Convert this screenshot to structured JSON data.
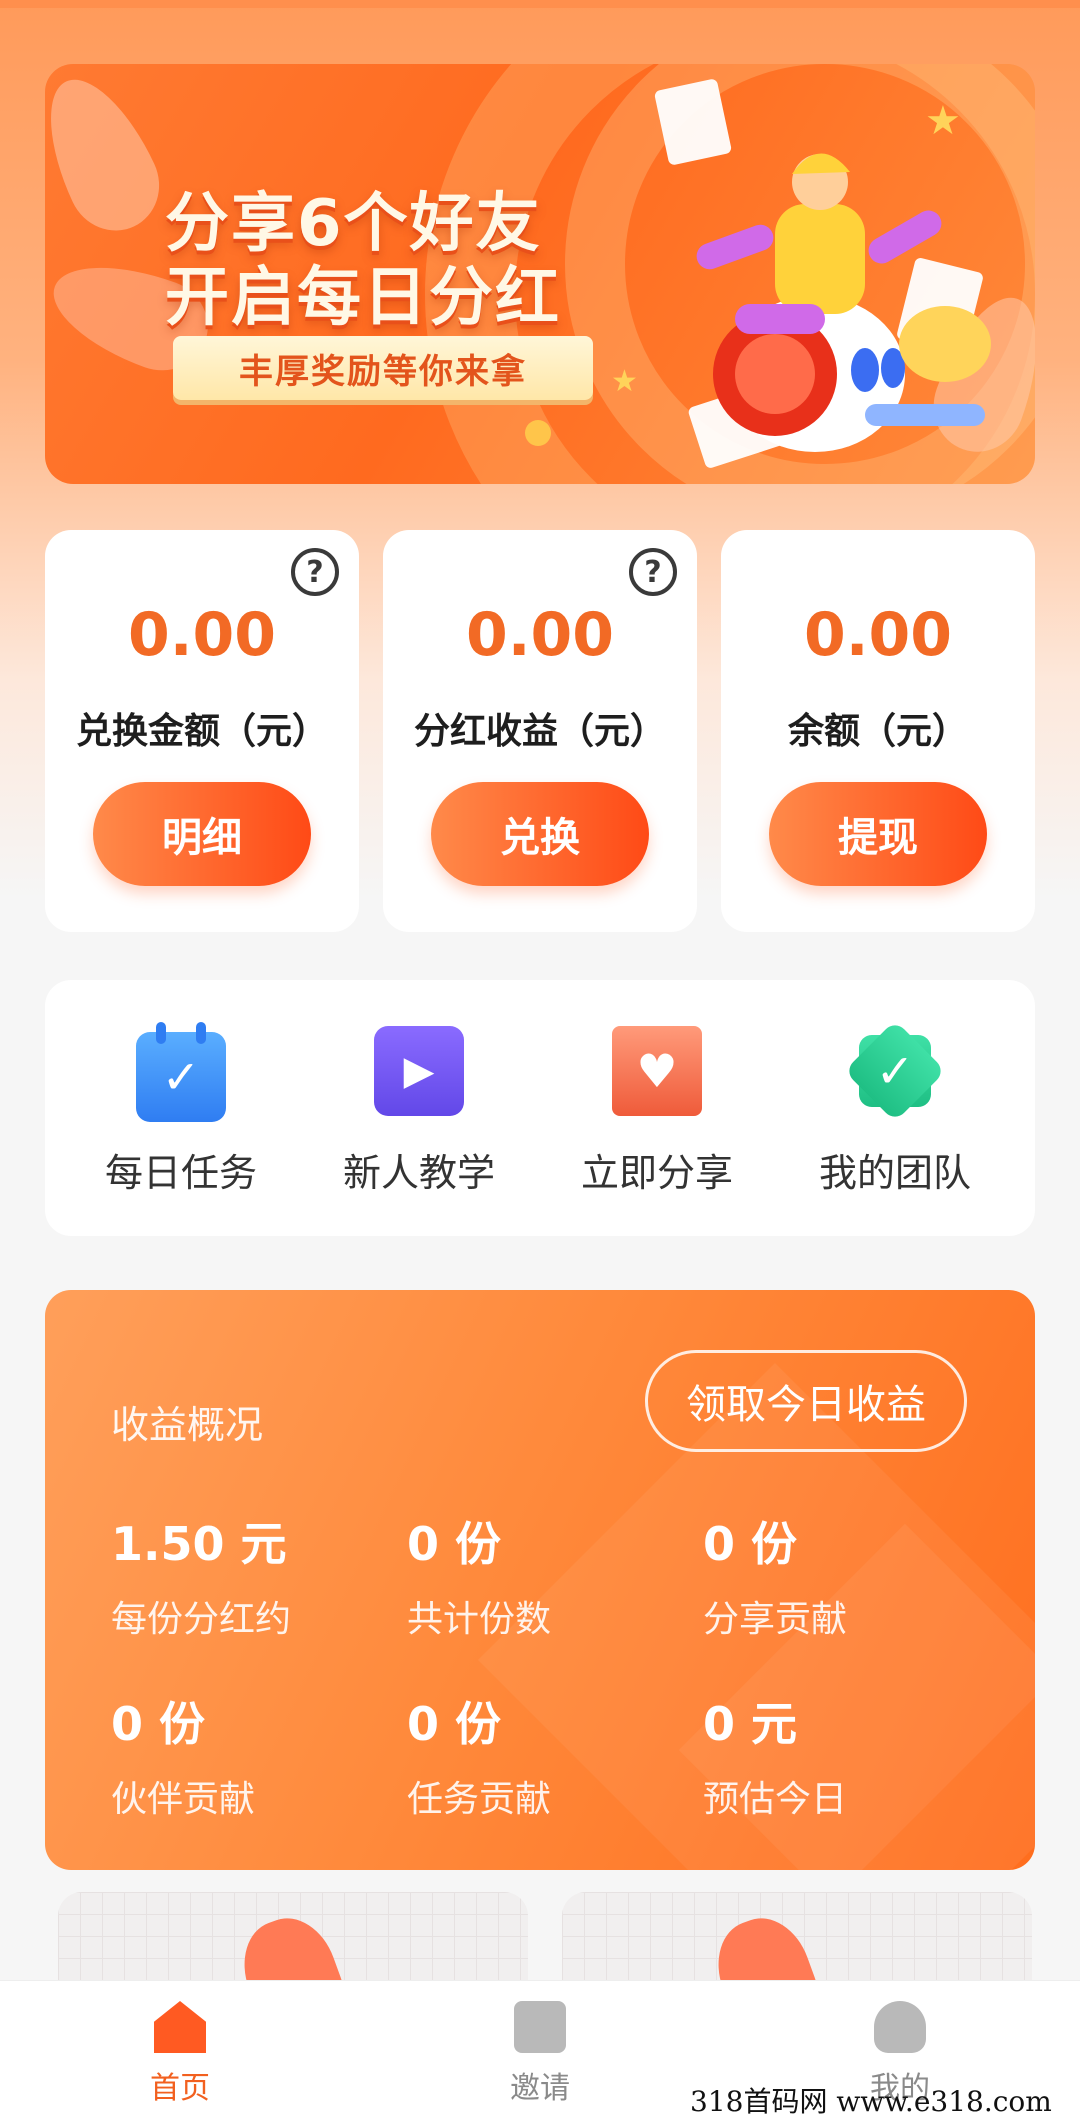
{
  "banner": {
    "title_line1": "分享6个好友",
    "title_line2": "开启每日分红",
    "ribbon": "丰厚奖励等你来拿"
  },
  "cards": [
    {
      "value": "0.00",
      "label": "兑换金额（元）",
      "button": "明细",
      "help": "?"
    },
    {
      "value": "0.00",
      "label": "分红收益（元）",
      "button": "兑换",
      "help": "?"
    },
    {
      "value": "0.00",
      "label": "余额（元）",
      "button": "提现"
    }
  ],
  "quick_actions": [
    {
      "label": "每日任务",
      "icon": "calendar-check-icon",
      "color": "#2f7df2"
    },
    {
      "label": "新人教学",
      "icon": "video-play-icon",
      "color": "#6248e8"
    },
    {
      "label": "立即分享",
      "icon": "heart-envelope-icon",
      "color": "#ef5b3a"
    },
    {
      "label": "我的团队",
      "icon": "badge-check-icon",
      "color": "#1fbf84"
    }
  ],
  "earnings": {
    "title": "收益概况",
    "claim_button": "领取今日收益",
    "stats": [
      {
        "value": "1.50 元",
        "label": "每份分红约"
      },
      {
        "value": "0 份",
        "label": "共计份数"
      },
      {
        "value": "0 份",
        "label": "分享贡献"
      },
      {
        "value": "0 份",
        "label": "伙伴贡献"
      },
      {
        "value": "0 份",
        "label": "任务贡献"
      },
      {
        "value": "0 元",
        "label": "预估今日"
      }
    ]
  },
  "tabbar": [
    {
      "label": "首页",
      "icon": "home-icon",
      "active": true
    },
    {
      "label": "邀请",
      "icon": "invite-badge-icon",
      "active": false
    },
    {
      "label": "我的",
      "icon": "profile-icon",
      "active": false
    }
  ],
  "watermark": "318首码网  www.e318.com",
  "colors": {
    "accent": "#f26a25",
    "button_gradient_start": "#ff8a4a",
    "button_gradient_end": "#ff4a16",
    "tab_active": "#f2601f",
    "tab_inactive": "#8a8a8a"
  }
}
